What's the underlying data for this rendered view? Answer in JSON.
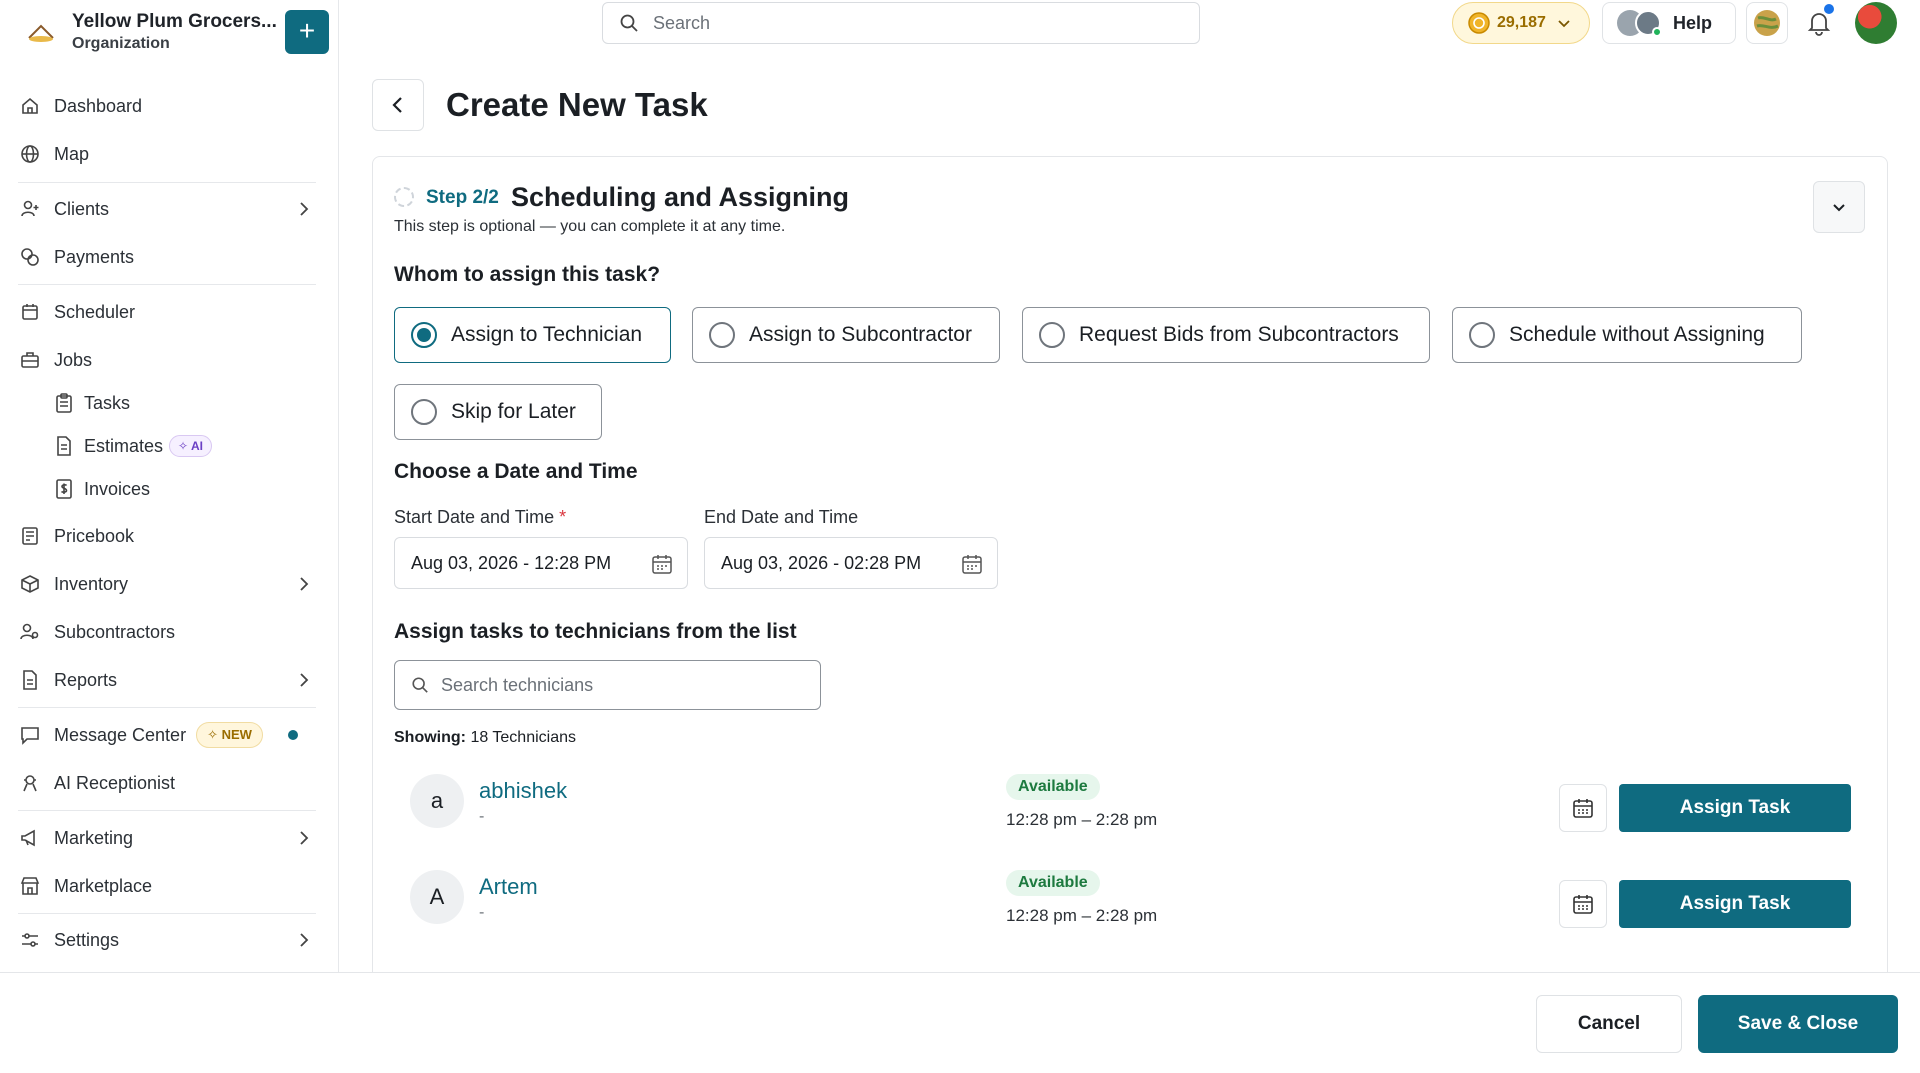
{
  "org": {
    "name": "Yellow Plum Grocers...",
    "type": "Organization",
    "add_label": "+"
  },
  "sidebar": {
    "items": [
      {
        "label": "Dashboard",
        "icon": "home-icon"
      },
      {
        "label": "Map",
        "icon": "globe-icon"
      },
      {
        "label": "Clients",
        "icon": "user-plus-icon",
        "has_chevron": true
      },
      {
        "label": "Payments",
        "icon": "coins-icon"
      },
      {
        "label": "Scheduler",
        "icon": "calendar-icon"
      },
      {
        "label": "Jobs",
        "icon": "briefcase-icon"
      },
      {
        "label": "Tasks",
        "icon": "clipboard-icon"
      },
      {
        "label": "Estimates",
        "icon": "document-icon",
        "badge": "AI"
      },
      {
        "label": "Invoices",
        "icon": "dollar-doc-icon"
      },
      {
        "label": "Pricebook",
        "icon": "book-icon"
      },
      {
        "label": "Inventory",
        "icon": "box-icon",
        "has_chevron": true
      },
      {
        "label": "Subcontractors",
        "icon": "users-icon"
      },
      {
        "label": "Reports",
        "icon": "report-icon",
        "has_chevron": true
      },
      {
        "label": "Message Center",
        "icon": "chat-icon",
        "badge": "NEW"
      },
      {
        "label": "AI Receptionist",
        "icon": "receptionist-icon"
      },
      {
        "label": "Marketing",
        "icon": "megaphone-icon",
        "has_chevron": true
      },
      {
        "label": "Marketplace",
        "icon": "store-icon"
      },
      {
        "label": "Settings",
        "icon": "sliders-icon",
        "has_chevron": true
      }
    ]
  },
  "topbar": {
    "search_placeholder": "Search",
    "points": "29,187",
    "help_label": "Help"
  },
  "page": {
    "title": "Create New Task"
  },
  "step": {
    "label": "Step 2/2",
    "title": "Scheduling and Assigning",
    "subtitle": "This step is optional — you can complete it at any time."
  },
  "assign": {
    "heading": "Whom to assign this task?",
    "options": [
      {
        "label": "Assign to Technician",
        "selected": true
      },
      {
        "label": "Assign to Subcontractor",
        "selected": false
      },
      {
        "label": "Request Bids from Subcontractors",
        "selected": false
      },
      {
        "label": "Schedule without Assigning",
        "selected": false
      },
      {
        "label": "Skip for Later",
        "selected": false
      }
    ]
  },
  "datetime": {
    "heading": "Choose a Date and Time",
    "start_label": "Start Date and Time",
    "required_mark": "*",
    "start_value": "Aug 03, 2026 - 12:28 PM",
    "end_label": "End Date and Time",
    "end_value": "Aug 03, 2026 - 02:28 PM"
  },
  "technicians": {
    "heading": "Assign tasks to technicians from the list",
    "search_placeholder": "Search technicians",
    "showing_label": "Showing:",
    "showing_value": "18 Technicians",
    "list": [
      {
        "initial": "a",
        "name": "abhishek",
        "sub": "-",
        "status": "Available",
        "time": "12:28 pm – 2:28 pm",
        "button": "Assign Task"
      },
      {
        "initial": "A",
        "name": "Artem",
        "sub": "-",
        "status": "Available",
        "time": "12:28 pm – 2:28 pm",
        "button": "Assign Task"
      }
    ]
  },
  "footer": {
    "cancel_label": "Cancel",
    "save_label": "Save & Close"
  },
  "colors": {
    "accent": "#0f6b80",
    "available_bg": "#e6f6ec",
    "available_text": "#1d7a3f"
  }
}
